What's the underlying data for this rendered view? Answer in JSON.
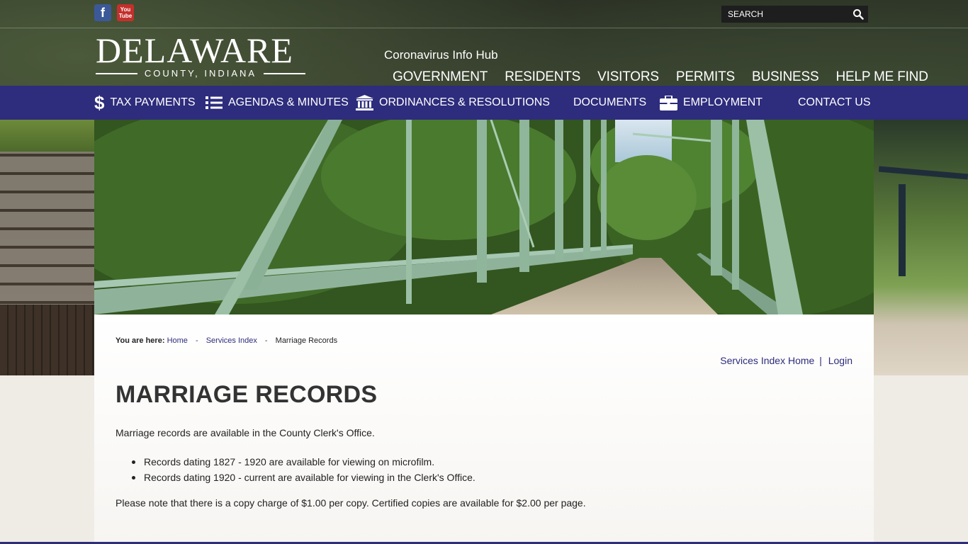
{
  "header": {
    "social": [
      "facebook-icon",
      "youtube-icon"
    ],
    "youtube_text": "You Tube",
    "search": {
      "placeholder": "SEARCH"
    },
    "logo": {
      "main": "DELAWARE",
      "sub": "COUNTY, INDIANA"
    },
    "covid_link": "Coronavirus Info Hub",
    "main_nav": [
      "GOVERNMENT",
      "RESIDENTS",
      "VISITORS",
      "PERMITS",
      "BUSINESS",
      "HELP ME FIND"
    ]
  },
  "quick_links": [
    {
      "label": "TAX PAYMENTS",
      "icon": "dollar-icon"
    },
    {
      "label": "AGENDAS & MINUTES",
      "icon": "list-icon"
    },
    {
      "label": "ORDINANCES & RESOLUTIONS",
      "icon": "courthouse-icon"
    },
    {
      "label": "DOCUMENTS",
      "icon": ""
    },
    {
      "label": "EMPLOYMENT",
      "icon": "briefcase-icon"
    },
    {
      "label": "CONTACT US",
      "icon": ""
    }
  ],
  "breadcrumb": {
    "prefix": "You are here:",
    "items": [
      "Home",
      "Services Index",
      "Marriage Records"
    ],
    "separator": "-"
  },
  "top_links": {
    "home": "Services Index Home",
    "pipe": "|",
    "login": "Login"
  },
  "page": {
    "title": "MARRIAGE RECORDS",
    "intro": "Marriage records are available in the County Clerk's Office.",
    "bullets": [
      "Records dating 1827 - 1920 are available for viewing on microfilm.",
      "Records dating 1920 - current are available for viewing in the Clerk's Office."
    ],
    "note": "Please note that there is a copy charge of $1.00 per copy. Certified copies are available for $2.00 per page."
  },
  "colors": {
    "nav_bar": "#2e2c7c",
    "link": "#2e2c7c",
    "title": "#333333"
  }
}
